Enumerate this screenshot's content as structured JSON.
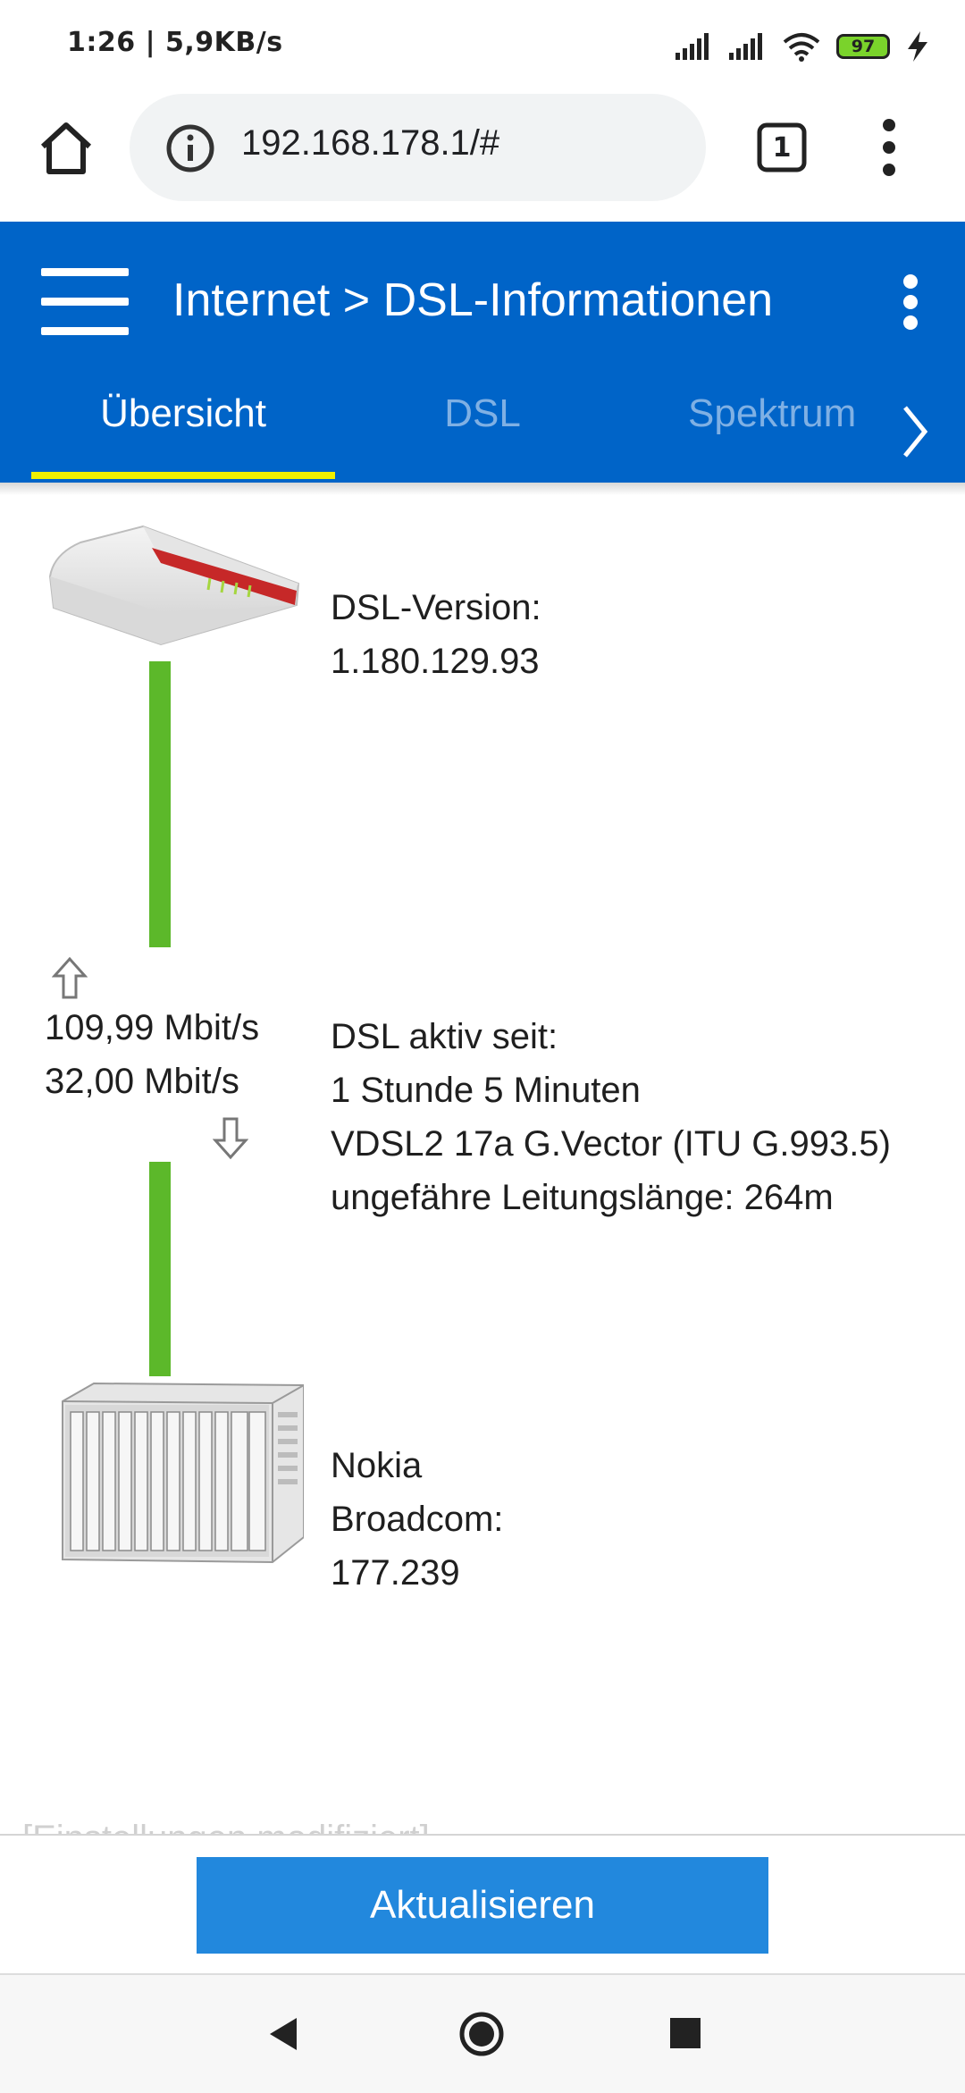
{
  "status_bar": {
    "time": "1:26",
    "speed": "5,9KB/s",
    "battery": "97"
  },
  "browser": {
    "url": "192.168.178.1/#",
    "tab_count": "1"
  },
  "app": {
    "title": "Internet > DSL-Informationen",
    "tabs": [
      {
        "label": "Übersicht",
        "active": true
      },
      {
        "label": "DSL",
        "active": false
      },
      {
        "label": "Spektrum",
        "active": false
      }
    ]
  },
  "overview": {
    "router_label": "DSL-Version:",
    "router_version": "1.180.129.93",
    "upload_speed": "109,99 Mbit/s",
    "download_speed": "32,00 Mbit/s",
    "dsl_active_label": "DSL aktiv seit:",
    "dsl_active_duration": "1 Stunde 5 Minuten",
    "dsl_mode": "VDSL2 17a G.Vector (ITU G.993.5)",
    "line_length": "ungefähre Leitungslänge: 264m",
    "dslam_vendor": "Nokia",
    "dslam_chipset_label": "Broadcom:",
    "dslam_chipset_version": "177.239"
  },
  "footer": {
    "note": "[Einstellungen modifiziert]",
    "refresh_label": "Aktualisieren"
  },
  "colors": {
    "header_blue": "#0064c8",
    "tab_underline": "#f0f000",
    "line_green": "#5cb82a",
    "button_blue": "#2288dd"
  }
}
